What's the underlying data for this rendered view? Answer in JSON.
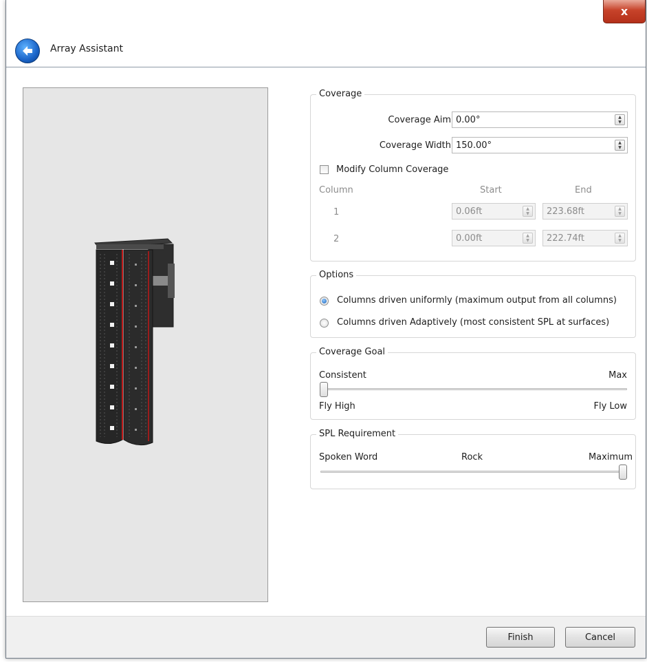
{
  "window": {
    "title": "Array Assistant",
    "close_glyph": "x"
  },
  "coverage": {
    "legend": "Coverage",
    "aim_label": "Coverage Aim",
    "aim_value": "0.00°",
    "width_label": "Coverage Width",
    "width_value": "150.00°",
    "modify_label": "Modify Column Coverage",
    "modify_checked": false,
    "table": {
      "headers": [
        "Column",
        "Start",
        "End"
      ],
      "rows": [
        {
          "column": "1",
          "start": "0.06ft",
          "end": "223.68ft"
        },
        {
          "column": "2",
          "start": "0.00ft",
          "end": "222.74ft"
        }
      ]
    }
  },
  "options": {
    "legend": "Options",
    "items": [
      {
        "label": "Columns driven uniformly (maximum output from all columns)",
        "selected": true
      },
      {
        "label": "Columns driven Adaptively (most consistent SPL at surfaces)",
        "selected": false
      }
    ]
  },
  "coverage_goal": {
    "legend": "Coverage Goal",
    "left_top": "Consistent",
    "right_top": "Max",
    "left_bottom": "Fly High",
    "right_bottom": "Fly Low",
    "level": 0
  },
  "spl": {
    "legend": "SPL Requirement",
    "left": "Spoken Word",
    "middle": "Rock",
    "right": "Maximum",
    "level": 1
  },
  "buttons": {
    "finish": "Finish",
    "cancel": "Cancel"
  },
  "icons": {
    "back": "back-arrow-icon",
    "close": "close-icon",
    "spin": "spinner-arrows-icon"
  }
}
